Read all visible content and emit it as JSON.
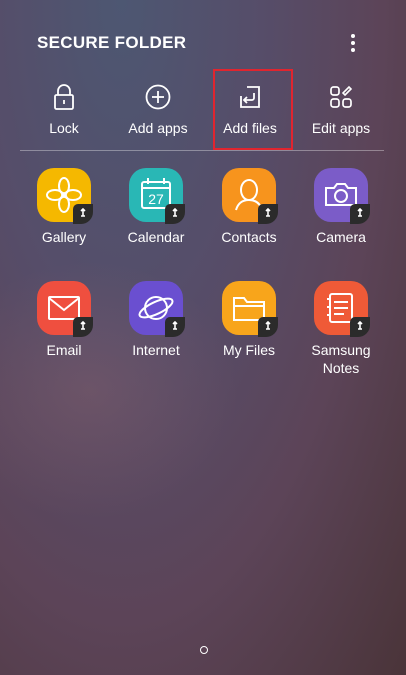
{
  "header": {
    "title": "SECURE FOLDER",
    "menu_icon": "more-vertical-icon"
  },
  "actions": [
    {
      "label": "Lock",
      "icon": "lock-icon"
    },
    {
      "label": "Add apps",
      "icon": "plus-circle-icon"
    },
    {
      "label": "Add files",
      "icon": "import-file-icon",
      "highlighted": true
    },
    {
      "label": "Edit apps",
      "icon": "edit-apps-icon"
    }
  ],
  "apps": [
    {
      "label": "Gallery",
      "icon": "gallery-icon",
      "color": "#f5b800"
    },
    {
      "label": "Calendar",
      "icon": "calendar-icon",
      "color": "#29b7b5",
      "date": "27"
    },
    {
      "label": "Contacts",
      "icon": "contacts-icon",
      "color": "#f7941d"
    },
    {
      "label": "Camera",
      "icon": "camera-icon",
      "color": "#7b5cc8"
    },
    {
      "label": "Email",
      "icon": "email-icon",
      "color": "#ef4f3f"
    },
    {
      "label": "Internet",
      "icon": "internet-icon",
      "color": "#6a4fd0"
    },
    {
      "label": "My Files",
      "icon": "folder-icon",
      "color": "#f8a51b"
    },
    {
      "label": "Samsung\nNotes",
      "label_line1": "Samsung",
      "label_line2": "Notes",
      "icon": "notes-icon",
      "color": "#ef5a37"
    }
  ],
  "navigation": {
    "home_indicator_icon": "home-dot-icon"
  }
}
